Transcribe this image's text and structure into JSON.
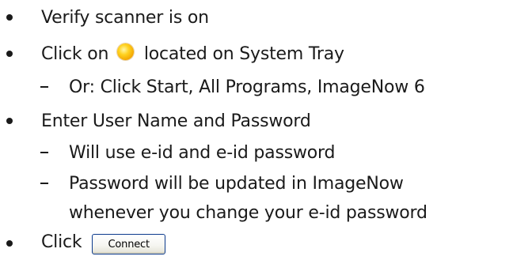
{
  "steps": [
    {
      "text": "Verify scanner is on"
    },
    {
      "before": "Click on",
      "after": "located on System Tray",
      "icon": "imagenow-tray-icon",
      "sub": [
        {
          "text": "Or: Click Start, All Programs, ImageNow 6"
        }
      ]
    },
    {
      "text": "Enter User Name and Password",
      "sub": [
        {
          "text": "Will use e-id and e-id password"
        },
        {
          "line1": "Password will be updated in ImageNow",
          "line2": "whenever you change your e-id password"
        }
      ]
    },
    {
      "before": "Click",
      "button_label": "Connect"
    }
  ],
  "colors": {
    "text": "#1a1a1a",
    "icon": "#ffc000",
    "button_border": "#0b3a8c"
  }
}
